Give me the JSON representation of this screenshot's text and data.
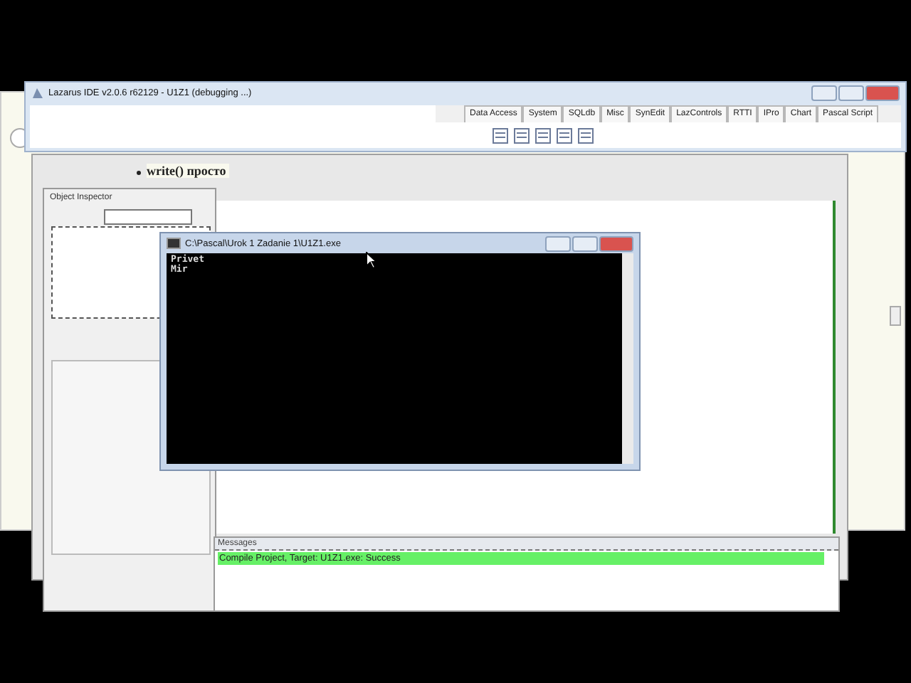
{
  "browser_page": {
    "bullet": "write() просто"
  },
  "ide_window": {
    "title": "Lazarus IDE v2.0.6 r62129 - U1Z1 (debugging ...)",
    "palette_tabs": [
      "Data Access",
      "System",
      "SQLdb",
      "Misc",
      "SynEdit",
      "LazControls",
      "RTTI",
      "IPro",
      "Chart",
      "Pascal Script"
    ]
  },
  "object_inspector": {
    "title": "Object Inspector"
  },
  "console_window": {
    "title": "C:\\Pascal\\Urok 1 Zadanie 1\\U1Z1.exe",
    "lines": [
      "Privet",
      "Mir"
    ]
  },
  "messages": {
    "title": "Messages",
    "items": [
      {
        "text": "Compile Project, Target: U1Z1.exe: Success",
        "kind": "success"
      }
    ]
  }
}
